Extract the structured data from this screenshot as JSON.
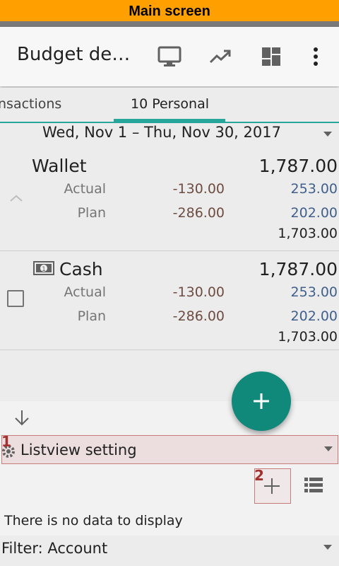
{
  "banner": {
    "text": "Main screen"
  },
  "app_bar": {
    "title": "Budget de…",
    "icons": [
      "monitor-icon",
      "trending-up-icon",
      "dashboard-icon",
      "more-vert-icon"
    ]
  },
  "tabs": [
    {
      "label": "nsactions"
    },
    {
      "label": "10 Personal",
      "selected": true
    }
  ],
  "date_range": "Wed, Nov 1 – Thu, Nov 30, 2017",
  "accounts": [
    {
      "name": "Wallet",
      "total": "1,787.00",
      "actual_label": "Actual",
      "actual_value": "-130.00",
      "actual_remaining": "253.00",
      "plan_label": "Plan",
      "plan_value": "-286.00",
      "plan_remaining": "202.00",
      "balance": "1,703.00"
    },
    {
      "name": "Cash",
      "total": "1,787.00",
      "actual_label": "Actual",
      "actual_value": "-130.00",
      "actual_remaining": "253.00",
      "plan_label": "Plan",
      "plan_value": "-286.00",
      "plan_remaining": "202.00",
      "balance": "1,703.00"
    }
  ],
  "listview": {
    "setting_label": "Listview setting",
    "marker_1": "1",
    "marker_2": "2",
    "empty_text": "There is no data to display"
  },
  "filter": {
    "label": "Filter: Account"
  },
  "colors": {
    "accent": "#26a69a",
    "fab": "#11897a",
    "banner": "#ffa000",
    "negative": "#6d4c41",
    "positive": "#3f5f8c"
  }
}
